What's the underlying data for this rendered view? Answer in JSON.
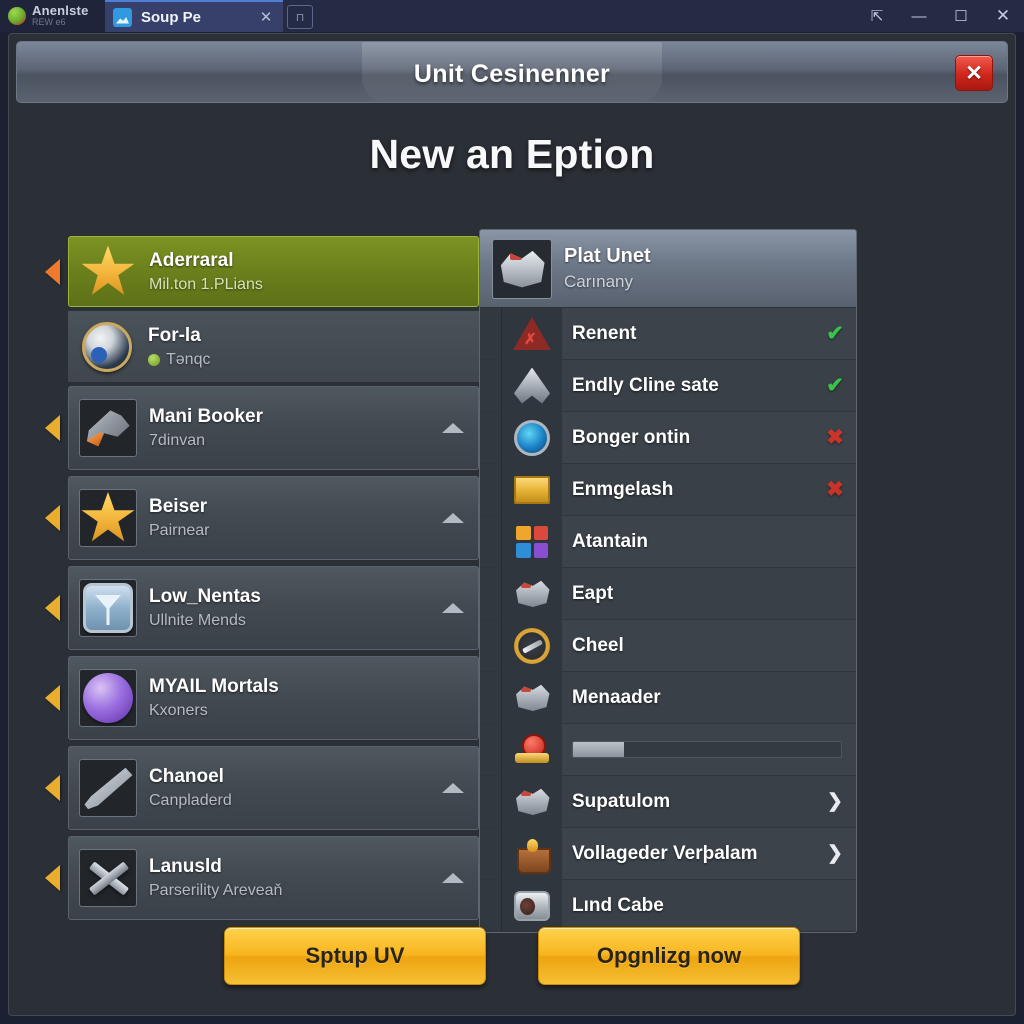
{
  "browser": {
    "background_tab": {
      "title": "Anenlste",
      "subtitle": "REW e6",
      "favicon": "plant-favicon"
    },
    "active_tab": {
      "title": "Soup Pe",
      "favicon": "image-favicon",
      "close_glyph": "✕"
    },
    "extra_tab_glyph": "⊓",
    "window_controls": {
      "share": "⇱",
      "minimize": "—",
      "maximize": "☐",
      "close": "✕"
    }
  },
  "dialog": {
    "titlebar_text": "Unit Cesinenner",
    "close_glyph": "✕",
    "page_title": "New an Eption"
  },
  "left_panel": {
    "items": [
      {
        "title": "Aderraral",
        "subtitle": "Mil.ton 1.PLians",
        "icon": "star-icon",
        "marker": "orange-chevron-marker",
        "selected": true,
        "caret": false,
        "dot": false
      },
      {
        "title": "For-la",
        "subtitle": "Tənqc",
        "icon": "globe-icon",
        "marker": "none",
        "selected": false,
        "caret": false,
        "dot": true
      },
      {
        "title": "Mani Booker",
        "subtitle": "7dinvan",
        "icon": "gun-icon",
        "marker": "yellow-chevron-marker",
        "selected": false,
        "caret": true,
        "dot": false
      },
      {
        "title": "Beiser",
        "subtitle": "Pairnear",
        "icon": "star-icon",
        "marker": "yellow-chevron-marker",
        "selected": false,
        "caret": true,
        "dot": false
      },
      {
        "title": "Low_Nentas",
        "subtitle": "Ullnite Mends",
        "icon": "screen-icon",
        "marker": "yellow-chevron-marker",
        "selected": false,
        "caret": true,
        "dot": false
      },
      {
        "title": "MYAIL Mortals",
        "subtitle": "Kxoners",
        "icon": "moon-icon",
        "marker": "yellow-chevron-marker",
        "selected": false,
        "caret": false,
        "dot": false
      },
      {
        "title": "Chanoel",
        "subtitle": "Canpladerd",
        "icon": "blade-icon",
        "marker": "yellow-chevron-marker",
        "selected": false,
        "caret": true,
        "dot": false
      },
      {
        "title": "Lanusld",
        "subtitle": "Parserility Areveaň",
        "icon": "tools-icon",
        "marker": "yellow-chevron-marker",
        "selected": false,
        "caret": true,
        "dot": false
      }
    ]
  },
  "right_panel": {
    "header": {
      "title": "Plat Unet",
      "subtitle": "Carınany",
      "icon": "engine-icon"
    },
    "rows": [
      {
        "label": "Renent",
        "icon": "red-triangle-icon",
        "status": "ok",
        "status_glyph": "✔"
      },
      {
        "label": "Endly Cline sate",
        "icon": "silver-arrow-icon",
        "status": "ok",
        "status_glyph": "✔"
      },
      {
        "label": "Bonger ontin",
        "icon": "blue-emblem-icon",
        "status": "no",
        "status_glyph": "✖"
      },
      {
        "label": "Enmgelash",
        "icon": "yellow-crate-icon",
        "status": "no",
        "status_glyph": "✖"
      },
      {
        "label": "Atantain",
        "icon": "color-grid-icon",
        "status": "none",
        "status_glyph": ""
      },
      {
        "label": "Eapt",
        "icon": "engine-parts-icon",
        "status": "none",
        "status_glyph": ""
      },
      {
        "label": "Cheel",
        "icon": "wheel-icon",
        "status": "none",
        "status_glyph": ""
      },
      {
        "label": "Menaader",
        "icon": "engine-parts-icon",
        "status": "none",
        "status_glyph": ""
      },
      {
        "label": "",
        "icon": "medal-icon",
        "status": "progress",
        "status_glyph": "",
        "progress_percent": 19
      },
      {
        "label": "Supatulom",
        "icon": "engine-parts-icon",
        "status": "next",
        "status_glyph": "❯"
      },
      {
        "label": "Vollageder Verþalam",
        "icon": "basket-icon",
        "status": "next",
        "status_glyph": "❯"
      },
      {
        "label": "Lınd Cabe",
        "icon": "ring-icon",
        "status": "none",
        "status_glyph": ""
      }
    ],
    "grid_colors": [
      "#f0a52c",
      "#d94a3d",
      "#2f8fd6",
      "#8a4fd0"
    ]
  },
  "footer": {
    "primary_label": "Sptup UV",
    "secondary_label": "Opgnlizg now"
  },
  "colors": {
    "selected_green": "#6b801c",
    "gold": "#f7b51f",
    "status_ok": "#39c34a",
    "status_no": "#c9342a",
    "dialog_bg": "#2b2f36"
  }
}
